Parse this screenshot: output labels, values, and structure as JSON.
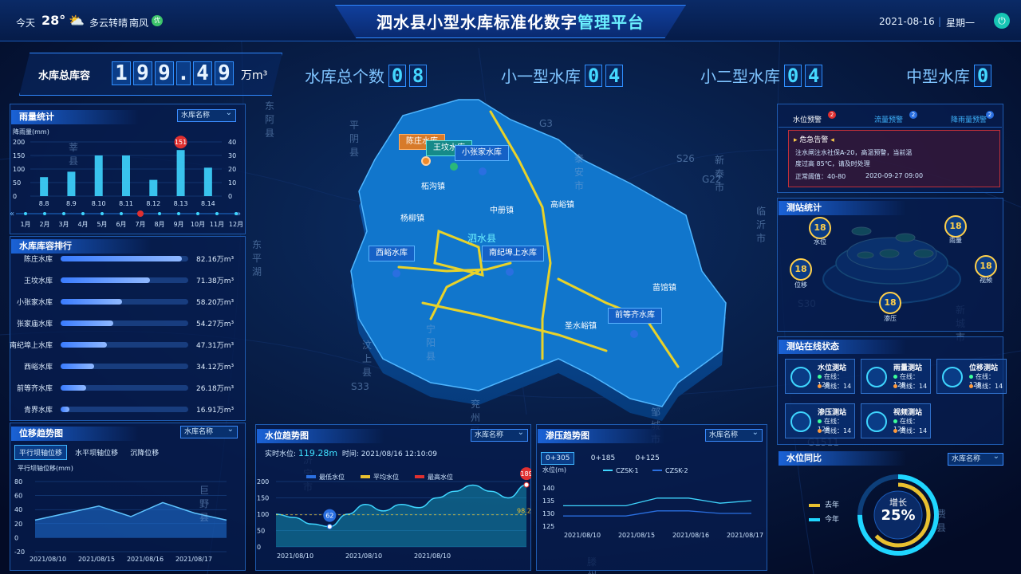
{
  "header": {
    "today_label": "今天",
    "temperature": "28°",
    "weather": "多云转晴",
    "wind": "南风",
    "wind_badge": "优",
    "title_main": "泗水县小型水库标准化数字",
    "title_hl": "管理平台",
    "date": "2021-08-16",
    "weekday": "星期一"
  },
  "capacity": {
    "label": "水库总库容",
    "digits": [
      "1",
      "9",
      "9",
      ".",
      "4",
      "9"
    ],
    "unit": "万m³"
  },
  "stats": [
    {
      "label": "水库总个数",
      "digits": [
        "0",
        "8"
      ]
    },
    {
      "label": "小一型水库",
      "digits": [
        "0",
        "4"
      ]
    },
    {
      "label": "小二型水库",
      "digits": [
        "0",
        "4"
      ]
    },
    {
      "label": "中型水库",
      "digits": [
        "0"
      ]
    }
  ],
  "rain": {
    "title": "雨量统计",
    "select": "水库名称",
    "ylabel": "降雨量(mm)",
    "left_ticks": [
      "200",
      "150",
      "100",
      "50",
      "0"
    ],
    "right_ticks": [
      "40",
      "30",
      "20",
      "10",
      "0"
    ],
    "peak_label": "151",
    "months": [
      "1月",
      "2月",
      "3月",
      "4月",
      "5月",
      "6月",
      "7月",
      "8月",
      "9月",
      "10月",
      "11月",
      "12月"
    ],
    "chart_data": {
      "type": "bar",
      "categories": [
        "8.8",
        "8.9",
        "8.10",
        "8.11",
        "8.12",
        "8.13",
        "8.14"
      ],
      "values": [
        70,
        90,
        150,
        150,
        60,
        170,
        105
      ],
      "ylabel": "降雨量(mm)",
      "ylim": [
        0,
        200
      ],
      "annotation": {
        "category": "8.13",
        "label": "151"
      }
    }
  },
  "ranking": {
    "title": "水库库容排行",
    "items": [
      {
        "name": "陈庄水库",
        "value": "82.16万m³",
        "pct": 0.95
      },
      {
        "name": "王坟水库",
        "value": "71.38万m³",
        "pct": 0.7
      },
      {
        "name": "小张家水库",
        "value": "58.20万m³",
        "pct": 0.48
      },
      {
        "name": "张家庙水库",
        "value": "54.27万m³",
        "pct": 0.41
      },
      {
        "name": "南纪埠上水库",
        "value": "47.31万m³",
        "pct": 0.36
      },
      {
        "name": "西峪水库",
        "value": "34.12万m³",
        "pct": 0.26
      },
      {
        "name": "前等齐水库",
        "value": "26.18万m³",
        "pct": 0.2
      },
      {
        "name": "青界水库",
        "value": "16.91万m³",
        "pct": 0.07
      }
    ]
  },
  "displacement": {
    "title": "位移趋势图",
    "select": "水库名称",
    "tabs": [
      "平行坝轴位移",
      "水平坝轴位移",
      "沉降位移"
    ],
    "ylabel": "平行坝轴位移(mm)",
    "yticks": [
      "80",
      "60",
      "40",
      "20",
      "0",
      "-20"
    ],
    "xticks": [
      "2021/08/10",
      "2021/08/15",
      "2021/08/16",
      "2021/08/17"
    ],
    "chart_data": {
      "type": "area",
      "x": [
        "2021/08/10",
        "2021/08/15",
        "2021/08/16",
        "2021/08/17"
      ],
      "series": [
        {
          "values": [
            25,
            35,
            45,
            30,
            50,
            35,
            25
          ]
        }
      ],
      "ylim": [
        -20,
        80
      ]
    }
  },
  "map": {
    "county": "泗水县",
    "reservoirs": [
      "陈庄水库",
      "王坟水库",
      "小张家水库",
      "西峪水库",
      "南纪埠上水库",
      "前等齐水库"
    ],
    "towns": [
      "柘沟镇",
      "杨柳镇",
      "中册镇",
      "高峪镇",
      "苗馆镇",
      "圣水峪镇"
    ],
    "base_labels": [
      "东阿县",
      "平阴县",
      "莘县",
      "东平湖",
      "汶上县",
      "宁阳县",
      "泰安市",
      "新泰市",
      "兖州区",
      "邹城市",
      "费县",
      "新城市",
      "巨野县",
      "济宁市",
      "临沂市",
      "滕州市",
      "G3",
      "S26",
      "G22",
      "S33",
      "S30",
      "G1511"
    ]
  },
  "water": {
    "title": "水位趋势图",
    "select": "水库名称",
    "realtime_label": "实时水位:",
    "realtime_value": "119.28m",
    "time_label": "时间:",
    "time_value": "2021/08/16 12:10:09",
    "legend": [
      "最低水位",
      "平均水位",
      "最高水位"
    ],
    "yticks": [
      "200",
      "150",
      "100",
      "50",
      "0"
    ],
    "xticks": [
      "2021/08/10",
      "2021/08/10",
      "2021/08/10"
    ],
    "min_label": "62",
    "max_label": "189",
    "avg_label": "98.2",
    "chart_data": {
      "type": "area",
      "ylim": [
        0,
        200
      ],
      "series": [
        {
          "name": "水位",
          "values": [
            100,
            90,
            70,
            62,
            100,
            130,
            110,
            130,
            120,
            150,
            170,
            189,
            170,
            150,
            190
          ]
        },
        {
          "name": "平均水位",
          "values": [
            98.2
          ]
        }
      ],
      "annotations": [
        {
          "label": "62",
          "kind": "最低水位"
        },
        {
          "label": "189",
          "kind": "最高水位"
        },
        {
          "label": "98.2",
          "kind": "平均水位"
        }
      ]
    }
  },
  "seepage": {
    "title": "渗压趋势图",
    "select": "水库名称",
    "tabs": [
      "0+305",
      "0+185",
      "0+125"
    ],
    "ylabel": "水位(m)",
    "legend": [
      "CZSK-1",
      "CZSK-2"
    ],
    "yticks": [
      "140",
      "135",
      "130",
      "125"
    ],
    "xticks": [
      "2021/08/10",
      "2021/08/15",
      "2021/08/16",
      "2021/08/17"
    ],
    "chart_data": {
      "type": "line",
      "x": [
        "2021/08/10",
        "2021/08/15",
        "2021/08/16",
        "2021/08/17"
      ],
      "ylim": [
        125,
        140
      ],
      "series": [
        {
          "name": "CZSK-1",
          "values": [
            133,
            133,
            133,
            136,
            136,
            134,
            135
          ]
        },
        {
          "name": "CZSK-2",
          "values": [
            129,
            129,
            129,
            131,
            131,
            130,
            130
          ]
        }
      ]
    }
  },
  "alerts": {
    "tabs": [
      {
        "label": "水位预警",
        "count": "2"
      },
      {
        "label": "流量预警",
        "count": "2"
      },
      {
        "label": "降雨量预警",
        "count": "2"
      }
    ],
    "heading": "危急告警",
    "lines": [
      "注水闸注水社保A-20，高温预警，当前温",
      "度过高 85℃，请及时处理"
    ],
    "normal_label": "正常阈值：40-80",
    "time": "2020-09-27 09:00"
  },
  "station_stats": {
    "title": "测站统计",
    "items": [
      {
        "label": "水位",
        "count": "18"
      },
      {
        "label": "雨量",
        "count": "18"
      },
      {
        "label": "位移",
        "count": "18"
      },
      {
        "label": "视频",
        "count": "18"
      },
      {
        "label": "渗压",
        "count": "18"
      }
    ]
  },
  "online": {
    "title": "测站在线状态",
    "online_label": "在线：",
    "offline_label": "离线：",
    "items": [
      {
        "name": "水位测站",
        "online": "128",
        "offline": "14"
      },
      {
        "name": "雨量测站",
        "online": "128",
        "offline": "14"
      },
      {
        "name": "位移测站",
        "online": "128",
        "offline": "14"
      },
      {
        "name": "渗压测站",
        "online": "128",
        "offline": "14"
      },
      {
        "name": "视频测站",
        "online": "128",
        "offline": "14"
      }
    ]
  },
  "yoy": {
    "title": "水位同比",
    "select": "水库名称",
    "legend": [
      "去年",
      "今年"
    ],
    "label": "增长",
    "value": "25%",
    "ratio": 0.25
  }
}
